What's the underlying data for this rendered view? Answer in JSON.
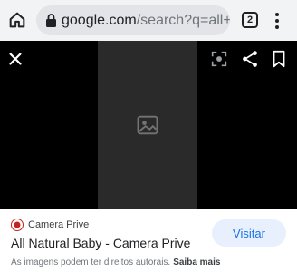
{
  "browser": {
    "url_host": "google.com",
    "url_path": "/search?q=all+r",
    "tab_count": "2",
    "icons": [
      "home-icon",
      "lock-icon",
      "tabs-icon",
      "menu-icon"
    ]
  },
  "viewer": {
    "background": "#000000",
    "icons": [
      "close-icon",
      "lens-icon",
      "share-icon",
      "bookmark-icon"
    ]
  },
  "result": {
    "source_name": "Camera Prive",
    "title": "All Natural Baby - Camera Prive",
    "visit_label": "Visitar",
    "copyright_text": "As imagens podem ter direitos autorais.",
    "learn_more_label": "Saiba mais"
  },
  "colors": {
    "toolbar": "#f1f3f4",
    "visit_button_bg": "#e8f0fe",
    "visit_button_text": "#1a73e8",
    "favicon": "#c5221f"
  }
}
